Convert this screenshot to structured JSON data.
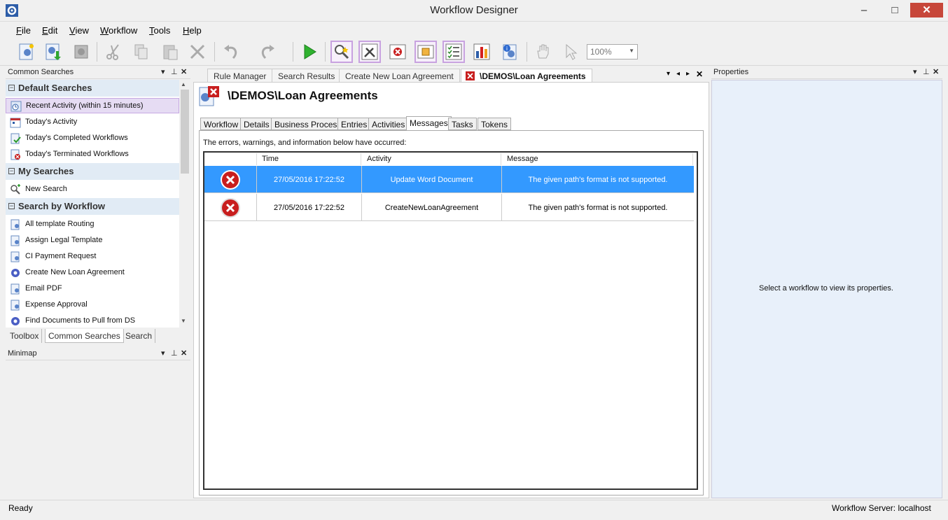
{
  "window": {
    "title": "Workflow Designer",
    "min": "–",
    "max": "□",
    "close": "✕"
  },
  "menu": [
    {
      "label": "File",
      "key": "F"
    },
    {
      "label": "Edit",
      "key": "E"
    },
    {
      "label": "View",
      "key": "V"
    },
    {
      "label": "Workflow",
      "key": "W"
    },
    {
      "label": "Tools",
      "key": "T"
    },
    {
      "label": "Help",
      "key": "H"
    }
  ],
  "toolbar": {
    "zoom": "100%"
  },
  "left_panel": {
    "title": "Common Searches",
    "groups": [
      {
        "label": "Default Searches",
        "items": [
          "Recent Activity (within 15 minutes)",
          "Today's Activity",
          "Today's Completed Workflows",
          "Today's Terminated Workflows"
        ]
      },
      {
        "label": "My Searches",
        "items": [
          "New Search"
        ]
      },
      {
        "label": "Search by Workflow",
        "items": [
          "All template Routing",
          "Assign Legal Template",
          "CI Payment Request",
          "Create New Loan Agreement",
          "Email PDF",
          "Expense Approval",
          "Find Documents to Pull from DS"
        ]
      }
    ],
    "tabs": [
      "Toolbox",
      "Common Searches",
      "Search"
    ]
  },
  "minimap": {
    "title": "Minimap"
  },
  "doc_tabs": [
    "Rule Manager",
    "Search Results",
    "Create New Loan Agreement",
    "\\DEMOS\\Loan Agreements"
  ],
  "document": {
    "title": "\\DEMOS\\Loan Agreements",
    "sub_tabs": [
      "Workflow",
      "Details",
      "Business Process",
      "Entries",
      "Activities",
      "Messages",
      "Tasks",
      "Tokens"
    ],
    "intro": "The errors, warnings, and information below have occurred:",
    "columns": [
      "Time",
      "Activity",
      "Message"
    ],
    "rows": [
      {
        "time": "27/05/2016 17:22:52",
        "activity": "Update Word Document",
        "message": "The given path's format is not supported."
      },
      {
        "time": "27/05/2016 17:22:52",
        "activity": "CreateNewLoanAgreement",
        "message": "The given path's format is not supported."
      }
    ]
  },
  "properties": {
    "title": "Properties",
    "empty": "Select a workflow to view its properties."
  },
  "status": {
    "left": "Ready",
    "right": "Workflow Server: localhost"
  }
}
